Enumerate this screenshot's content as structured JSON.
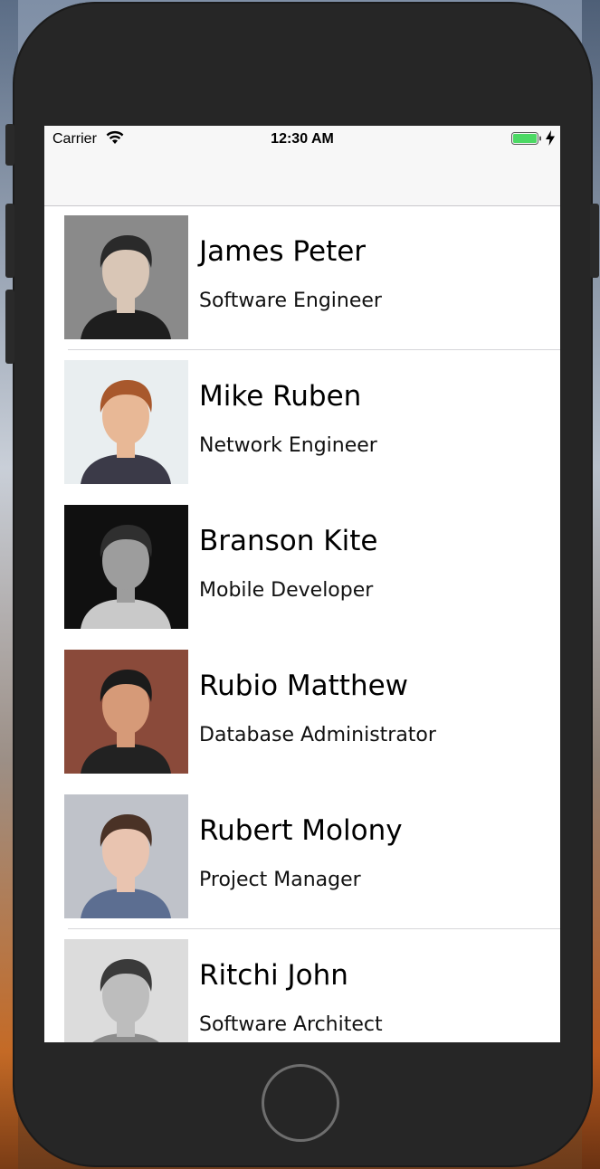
{
  "status_bar": {
    "carrier": "Carrier",
    "time": "12:30 AM",
    "battery_color": "#4cd964"
  },
  "contacts": [
    {
      "name": "James Peter",
      "title": "Software Engineer",
      "photo_icon": "person-photo-icon",
      "bg": "#8a8a8a",
      "skin": "#d9c6b6",
      "hair": "#2a2a2a",
      "shirt": "#1e1e1e"
    },
    {
      "name": "Mike Ruben",
      "title": "Network Engineer",
      "photo_icon": "person-photo-icon",
      "bg": "#e9eef0",
      "skin": "#e8b896",
      "hair": "#a8582c",
      "shirt": "#3b3a48"
    },
    {
      "name": "Branson Kite",
      "title": "Mobile Developer",
      "photo_icon": "person-photo-icon",
      "bg": "#101010",
      "skin": "#9d9d9d",
      "hair": "#2f2f2f",
      "shirt": "#c9c9c9"
    },
    {
      "name": "Rubio Matthew",
      "title": "Database Administrator",
      "photo_icon": "person-photo-icon",
      "bg": "#8a4a3a",
      "skin": "#d69a78",
      "hair": "#1b1b1b",
      "shirt": "#222222"
    },
    {
      "name": "Rubert Molony",
      "title": "Project Manager",
      "photo_icon": "person-photo-icon",
      "bg": "#bfc2c9",
      "skin": "#e9c4b0",
      "hair": "#4a3226",
      "shirt": "#5c6e91"
    },
    {
      "name": "Ritchi John",
      "title": "Software Architect",
      "photo_icon": "person-photo-icon",
      "bg": "#dcdcdc",
      "skin": "#bdbdbd",
      "hair": "#3a3a3a",
      "shirt": "#8c8c8c"
    }
  ]
}
